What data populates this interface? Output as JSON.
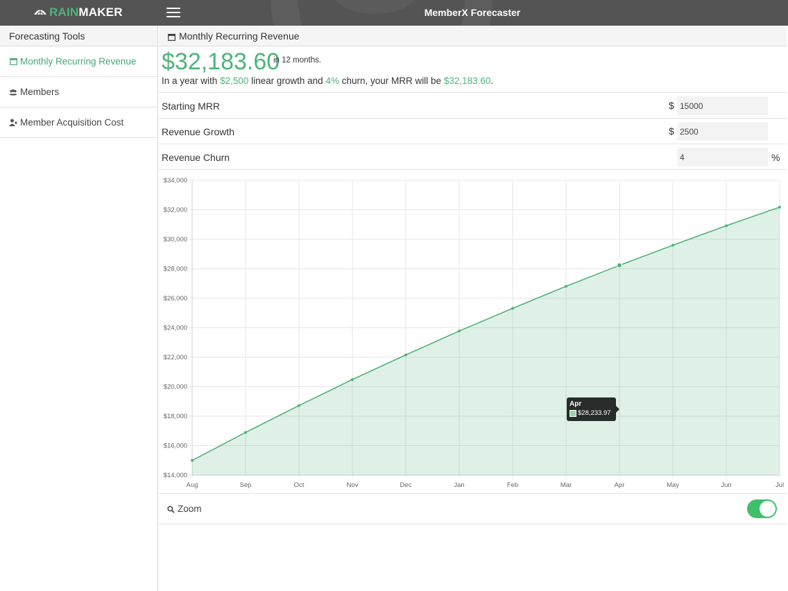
{
  "navbar": {
    "brand_rain": "RAIN",
    "brand_maker": "MAKER",
    "title": "MemberX Forecaster"
  },
  "sidebar": {
    "header": "Forecasting Tools",
    "items": [
      {
        "label": "Monthly Recurring Revenue",
        "icon": "calendar-icon",
        "active": true
      },
      {
        "label": "Members",
        "icon": "group-icon"
      },
      {
        "label": "Member Acquisition Cost",
        "icon": "user-add-icon"
      }
    ]
  },
  "main": {
    "header": "Monthly Recurring Revenue",
    "summary": {
      "value": "$32,183.60",
      "period": "in 12 months.",
      "sentence_prefix": "In a year with",
      "growth": "$2,500",
      "sentence_mid1": "linear growth and",
      "churn": "4%",
      "sentence_mid2": "churn, your MRR will be",
      "result": "$32,183.60",
      "sentence_end": "."
    },
    "fields": [
      {
        "label": "Starting MRR",
        "prefix": "$",
        "value": "15000"
      },
      {
        "label": "Revenue Growth",
        "prefix": "$",
        "value": "2500"
      },
      {
        "label": "Revenue Churn",
        "suffix": "%",
        "value": "4"
      }
    ],
    "tooltip": {
      "title": "Apr",
      "value": "$28,233.97"
    },
    "zoom": {
      "label": "Zoom",
      "enabled": true
    }
  },
  "colors": {
    "accent": "#4fb37a",
    "navbar": "#545454",
    "toggle": "#3ec06b"
  },
  "chart_data": {
    "type": "area",
    "x": [
      "Aug",
      "Sep",
      "Oct",
      "Nov",
      "Dec",
      "Jan",
      "Feb",
      "Mar",
      "Apr",
      "May",
      "Jun",
      "Jul"
    ],
    "series": [
      {
        "values": [
          15000,
          16900,
          18720,
          20490,
          22160,
          23780,
          25320,
          26810,
          28233.97,
          29600,
          30920,
          32183.6
        ]
      }
    ],
    "ylim": [
      14000,
      34000
    ],
    "yticks": [
      "$34,000",
      "$32,000",
      "$30,000",
      "$28,000",
      "$26,000",
      "$24,000",
      "$22,000",
      "$20,000",
      "$18,000",
      "$16,000",
      "$14,000"
    ],
    "grid": true,
    "highlight_index": 8
  }
}
